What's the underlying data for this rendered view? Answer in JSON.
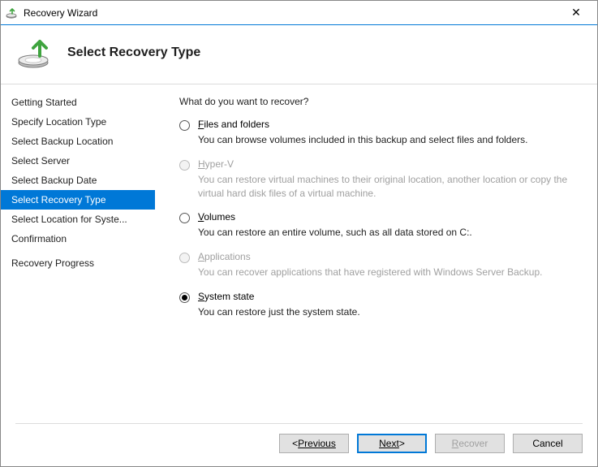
{
  "window": {
    "title": "Recovery Wizard"
  },
  "header": {
    "title": "Select Recovery Type"
  },
  "sidebar": {
    "items": [
      {
        "label": "Getting Started",
        "group": "before"
      },
      {
        "label": "Specify Location Type",
        "group": "before"
      },
      {
        "label": "Select Backup Location",
        "group": "before"
      },
      {
        "label": "Select Server",
        "group": "before"
      },
      {
        "label": "Select Backup Date",
        "group": "before"
      },
      {
        "label": "Select Recovery Type",
        "group": "active"
      },
      {
        "label": "Select Location for Syste...",
        "group": "after"
      },
      {
        "label": "Confirmation",
        "group": "after"
      },
      {
        "label": "Recovery Progress",
        "group": "after2"
      }
    ]
  },
  "main": {
    "prompt": "What do you want to recover?",
    "options": [
      {
        "key": "files",
        "label": "Files and folders",
        "desc": "You can browse volumes included in this backup and select files and folders.",
        "disabled": false,
        "selected": false
      },
      {
        "key": "hyperv",
        "label": "Hyper-V",
        "desc": "You can restore virtual machines to their original location, another location or copy the virtual hard disk files of a virtual machine.",
        "disabled": true,
        "selected": false
      },
      {
        "key": "volumes",
        "label": "Volumes",
        "desc": "You can restore an entire volume, such as all data stored on C:.",
        "disabled": false,
        "selected": false
      },
      {
        "key": "applications",
        "label": "Applications",
        "desc": "You can recover applications that have registered with Windows Server Backup.",
        "disabled": true,
        "selected": false
      },
      {
        "key": "systemstate",
        "label": "System state",
        "desc": "You can restore just the system state.",
        "disabled": false,
        "selected": true
      }
    ]
  },
  "footer": {
    "previous": "Previous",
    "next": "Next",
    "recover": "Recover",
    "cancel": "Cancel"
  }
}
